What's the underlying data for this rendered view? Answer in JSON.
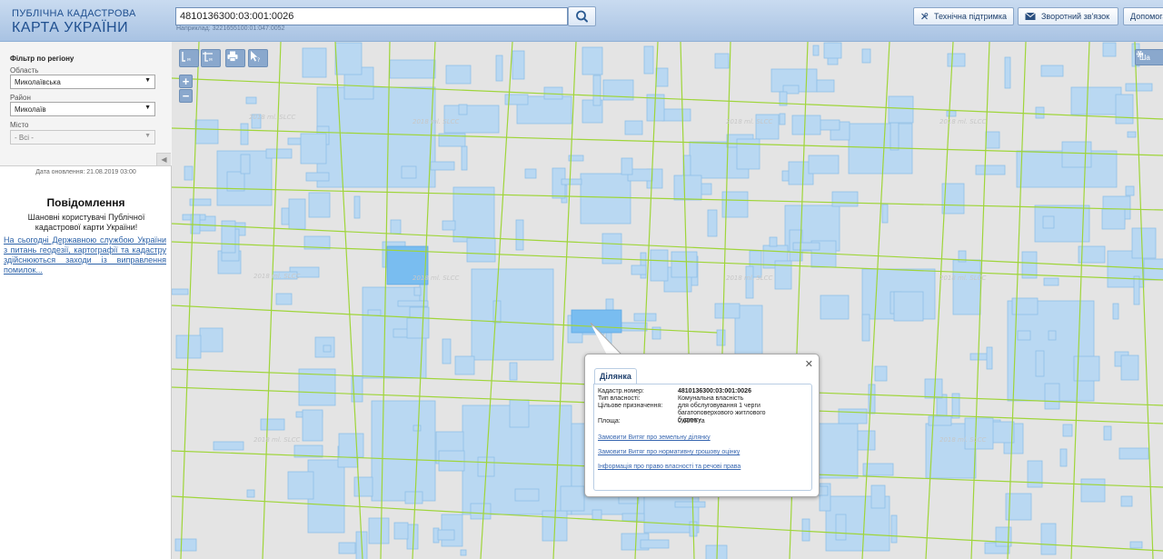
{
  "header": {
    "logo_line1": "ПУБЛІЧНА КАДАСТРОВА",
    "logo_line2": "КАРТА УКРАЇНИ",
    "search_value": "4810136300:03:001:0026",
    "search_hint": "Наприклад: 3221655100:01:047:0052",
    "buttons": {
      "support": "Технічна підтримка",
      "feedback": "Зворотний зв'язок",
      "help": "Допомога"
    }
  },
  "sidebar": {
    "filter_title": "Фільтр по регіону",
    "region_label": "Область",
    "region_value": "Миколаївська",
    "district_label": "Район",
    "district_value": "Миколаїв",
    "city_label": "Місто",
    "city_value": "- Всі -",
    "update_date": "Дата оновлення: 21.08.2019 03:00",
    "notice_title": "Повідомлення",
    "notice_text": "Шановні користувачі Публічної кадастрової карти України!",
    "notice_link": "На сьогодні Державною службою України з питань геодезії, картографії та кадастру здійснюються заходи із виправлення помилок..."
  },
  "map": {
    "zoom_in": "+",
    "zoom_out": "−",
    "layers_label": "Ша",
    "watermark": "2018 ml. SLCC",
    "colors": {
      "background": "#e4e4e4",
      "parcel_fill": "#b9d8f2",
      "parcel_stroke": "#8fc0e6",
      "selected_fill": "#79bdf0",
      "road_line": "#9fd53a"
    }
  },
  "popup": {
    "tab": "Ділянка",
    "rows": [
      {
        "label": "Кадастр.номер:",
        "value": "4810136300:03:001:0026"
      },
      {
        "label": "Тип власності:",
        "value": "Комунальна власність"
      },
      {
        "label": "Цільове призначення:",
        "value": "для обслуговування 1 черги багатоповерхового житлового будинку"
      },
      {
        "label": "Площа:",
        "value": "0.6006 га"
      }
    ],
    "links": [
      "Замовити Витяг про земельну ділянку",
      "Замовити Витяг про нормативну грошову оцінку",
      "Інформація про право власності та речові права"
    ]
  }
}
